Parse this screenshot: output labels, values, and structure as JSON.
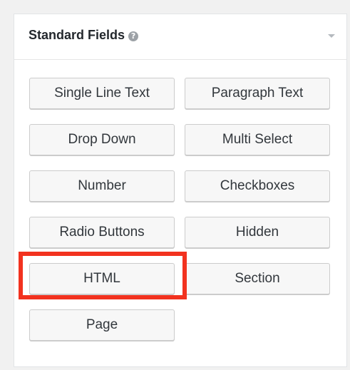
{
  "panel": {
    "title": "Standard Fields",
    "help_icon": "question-circle-icon",
    "toggle_icon": "caret-down-icon"
  },
  "fields": {
    "single_line_text": "Single Line Text",
    "paragraph_text": "Paragraph Text",
    "drop_down": "Drop Down",
    "multi_select": "Multi Select",
    "number": "Number",
    "checkboxes": "Checkboxes",
    "radio_buttons": "Radio Buttons",
    "hidden": "Hidden",
    "html": "HTML",
    "section": "Section",
    "page": "Page"
  },
  "highlight": {
    "target": "html",
    "color": "#f2321f"
  }
}
